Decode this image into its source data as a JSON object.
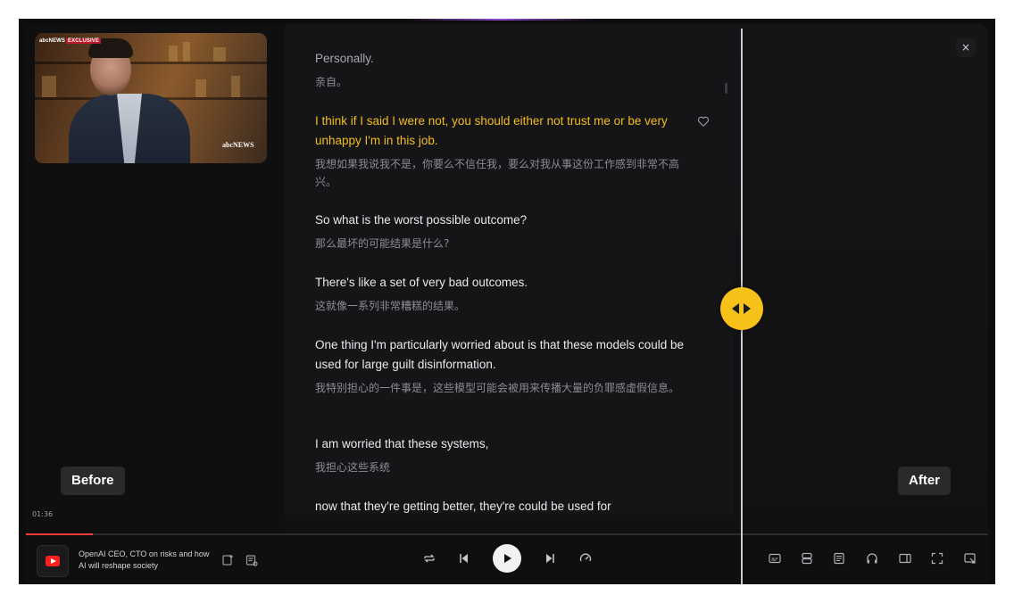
{
  "video": {
    "overlay_tag_news": "abcNEWS",
    "overlay_tag_exclusive": "EXCLUSIVE",
    "overlay_logo": "abcNEWS",
    "time": "01:36",
    "progress_fraction": 0.07
  },
  "labels": {
    "before": "Before",
    "after": "After"
  },
  "transcript": [
    {
      "en": "Personally.",
      "zh": "亲自。",
      "state": "dim"
    },
    {
      "en": "I think if I said I were not, you should either not trust me or be very unhappy I'm in this job.",
      "zh": "我想如果我说我不是，你要么不信任我，要么对我从事这份工作感到非常不高兴。",
      "state": "active"
    },
    {
      "en": "So what is the worst possible outcome?",
      "zh": "那么最坏的可能结果是什么?",
      "state": "normal"
    },
    {
      "en": "There's like a set of very bad outcomes.",
      "zh": "这就像一系列非常糟糕的结果。",
      "state": "normal"
    },
    {
      "en": "One thing I'm particularly worried about is that these models could be used for large guilt disinformation.",
      "zh": "我特别担心的一件事是，这些模型可能会被用来传播大量的负罪感虚假信息。",
      "state": "normal"
    },
    {
      "en": "I am worried that these systems,",
      "zh": "我担心这些系统",
      "state": "normal"
    },
    {
      "en": "now that they're getting better, they're could be used for",
      "zh": "",
      "state": "normal"
    }
  ],
  "player": {
    "source_icon": "youtube-icon",
    "title": "OpenAI CEO, CTO on risks and how AI will reshape society",
    "accent": "#f6c21a",
    "progress_color": "#ff3b3b"
  },
  "window": {
    "close_glyph": "×"
  }
}
